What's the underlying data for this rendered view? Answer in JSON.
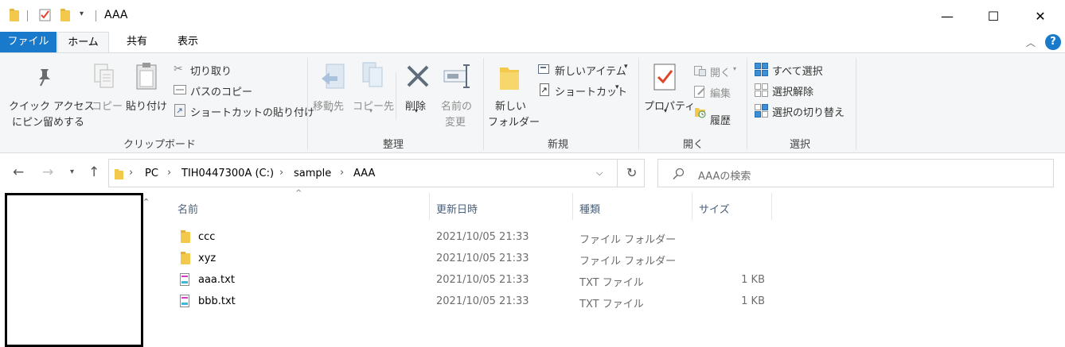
{
  "window": {
    "title": "AAA",
    "minimize": "—",
    "maximize": "☐",
    "close": "✕"
  },
  "ribbon_tabs": {
    "file": "ファイル",
    "home": "ホーム",
    "share": "共有",
    "view": "表示",
    "help": "?"
  },
  "clipboard": {
    "pin": "クイック アクセス",
    "pin_line2": "にピン留めする",
    "copy": "コピー",
    "paste": "貼り付け",
    "cut": "切り取り",
    "copy_path": "パスのコピー",
    "paste_shortcut": "ショートカットの貼り付け",
    "group": "クリップボード"
  },
  "organize": {
    "move_to": "移動先",
    "copy_to": "コピー先",
    "delete": "削除",
    "rename": "名前の",
    "rename_line2": "変更",
    "group": "整理"
  },
  "new": {
    "new_folder": "新しい",
    "new_folder_line2": "フォルダー",
    "new_item": "新しいアイテム",
    "shortcut": "ショートカット",
    "group": "新規"
  },
  "open": {
    "properties": "プロパティ",
    "open": "開く",
    "edit": "編集",
    "history": "履歴",
    "group": "開く"
  },
  "select": {
    "select_all": "すべて選択",
    "select_none": "選択解除",
    "invert": "選択の切り替え",
    "group": "選択"
  },
  "address": {
    "crumbs": [
      "PC",
      "TIH0447300A (C:)",
      "sample",
      "AAA"
    ],
    "search_placeholder": "AAAの検索"
  },
  "columns": {
    "name": "名前",
    "date": "更新日時",
    "type": "種類",
    "size": "サイズ"
  },
  "files": [
    {
      "name": "ccc",
      "date": "2021/10/05 21:33",
      "type": "ファイル フォルダー",
      "size": "",
      "icon": "folder-icon"
    },
    {
      "name": "xyz",
      "date": "2021/10/05 21:33",
      "type": "ファイル フォルダー",
      "size": "",
      "icon": "folder-icon"
    },
    {
      "name": "aaa.txt",
      "date": "2021/10/05 21:33",
      "type": "TXT ファイル",
      "size": "1 KB",
      "icon": "text-file-icon"
    },
    {
      "name": "bbb.txt",
      "date": "2021/10/05 21:33",
      "type": "TXT ファイル",
      "size": "1 KB",
      "icon": "text-file-icon"
    }
  ]
}
